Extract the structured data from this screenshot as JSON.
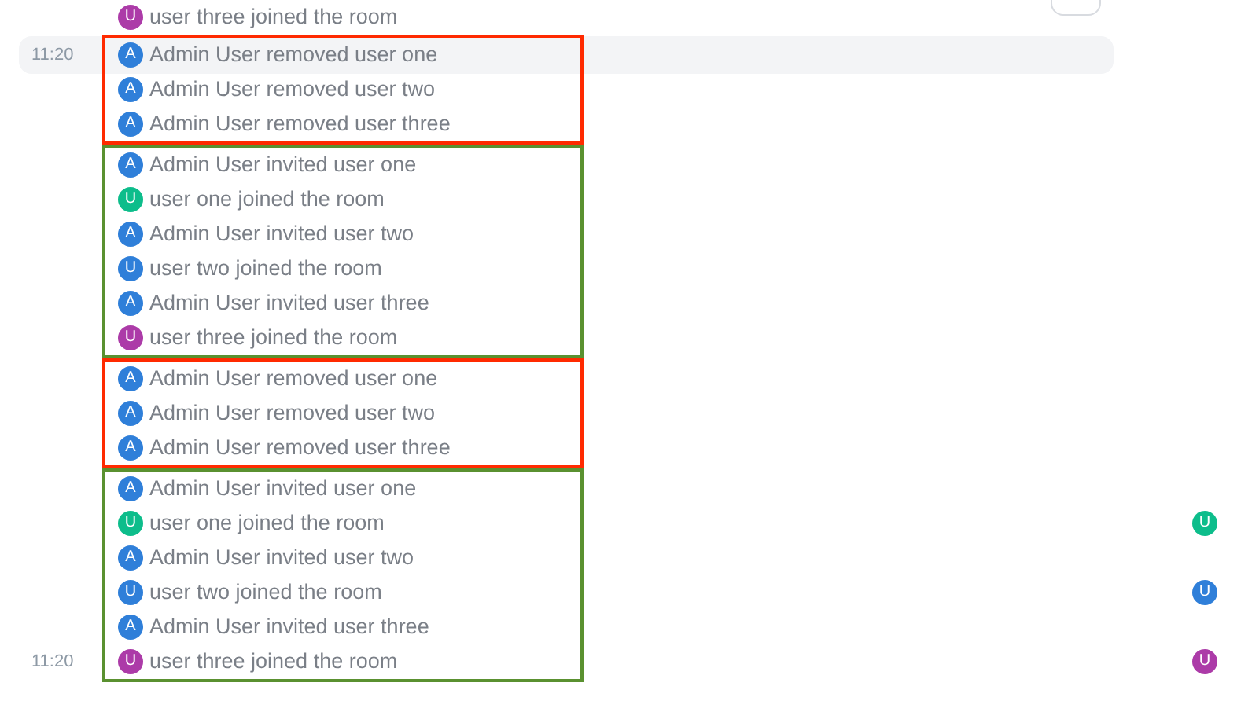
{
  "events_before": [
    {
      "avatar": {
        "letter": "U",
        "color": "#ac3ba8"
      },
      "text": "user three joined the room",
      "highlighted": false
    }
  ],
  "groups": [
    {
      "color": "#ff2a00",
      "events": [
        {
          "time": "11:20",
          "highlighted": true,
          "avatar": {
            "letter": "A",
            "color": "#2f7fd9"
          },
          "text": "Admin User removed user one"
        },
        {
          "highlighted": false,
          "avatar": {
            "letter": "A",
            "color": "#2f7fd9"
          },
          "text": "Admin User removed user two"
        },
        {
          "highlighted": false,
          "avatar": {
            "letter": "A",
            "color": "#2f7fd9"
          },
          "text": "Admin User removed user three"
        }
      ]
    },
    {
      "color": "#5a9130",
      "events": [
        {
          "highlighted": false,
          "avatar": {
            "letter": "A",
            "color": "#2f7fd9"
          },
          "text": "Admin User invited user one"
        },
        {
          "highlighted": false,
          "avatar": {
            "letter": "U",
            "color": "#0dbd8b"
          },
          "text": "user one joined the room"
        },
        {
          "highlighted": false,
          "avatar": {
            "letter": "A",
            "color": "#2f7fd9"
          },
          "text": "Admin User invited user two"
        },
        {
          "highlighted": false,
          "avatar": {
            "letter": "U",
            "color": "#2f7fd9"
          },
          "text": "user two joined the room"
        },
        {
          "highlighted": false,
          "avatar": {
            "letter": "A",
            "color": "#2f7fd9"
          },
          "text": "Admin User invited user three"
        },
        {
          "highlighted": false,
          "avatar": {
            "letter": "U",
            "color": "#ac3ba8"
          },
          "text": "user three joined the room"
        }
      ]
    },
    {
      "color": "#ff2a00",
      "events": [
        {
          "highlighted": false,
          "avatar": {
            "letter": "A",
            "color": "#2f7fd9"
          },
          "text": "Admin User removed user one"
        },
        {
          "highlighted": false,
          "avatar": {
            "letter": "A",
            "color": "#2f7fd9"
          },
          "text": "Admin User removed user two"
        },
        {
          "highlighted": false,
          "avatar": {
            "letter": "A",
            "color": "#2f7fd9"
          },
          "text": "Admin User removed user three"
        }
      ]
    },
    {
      "color": "#5a9130",
      "events": [
        {
          "highlighted": false,
          "avatar": {
            "letter": "A",
            "color": "#2f7fd9"
          },
          "text": "Admin User invited user one"
        },
        {
          "highlighted": false,
          "avatar": {
            "letter": "U",
            "color": "#0dbd8b"
          },
          "text": "user one joined the room",
          "read_receipt": {
            "letter": "U",
            "color": "#0dbd8b"
          }
        },
        {
          "highlighted": false,
          "avatar": {
            "letter": "A",
            "color": "#2f7fd9"
          },
          "text": "Admin User invited user two"
        },
        {
          "highlighted": false,
          "avatar": {
            "letter": "U",
            "color": "#2f7fd9"
          },
          "text": "user two joined the room",
          "read_receipt": {
            "letter": "U",
            "color": "#2f7fd9"
          }
        },
        {
          "highlighted": false,
          "avatar": {
            "letter": "A",
            "color": "#2f7fd9"
          },
          "text": "Admin User invited user three"
        },
        {
          "time": "11:20",
          "highlighted": false,
          "avatar": {
            "letter": "U",
            "color": "#ac3ba8"
          },
          "text": "user three joined the room",
          "read_receipt": {
            "letter": "U",
            "color": "#ac3ba8"
          }
        }
      ]
    }
  ]
}
